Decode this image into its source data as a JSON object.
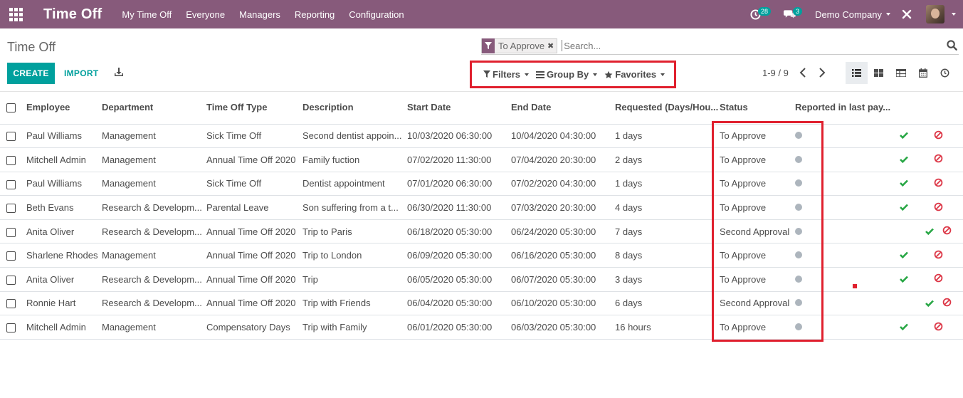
{
  "navbar": {
    "app_title": "Time Off",
    "menu": [
      "My Time Off",
      "Everyone",
      "Managers",
      "Reporting",
      "Configuration"
    ],
    "activity_count": "28",
    "message_count": "3",
    "company": "Demo Company",
    "bg_color": "#875a7b"
  },
  "control_panel": {
    "title": "Time Off",
    "search": {
      "facet_label": "To Approve",
      "placeholder": "Search..."
    },
    "create_label": "CREATE",
    "import_label": "IMPORT",
    "filters_label": "Filters",
    "groupby_label": "Group By",
    "favorites_label": "Favorites",
    "pager": "1-9 / 9"
  },
  "table": {
    "headers": [
      "Employee",
      "Department",
      "Time Off Type",
      "Description",
      "Start Date",
      "End Date",
      "Requested (Days/Hou...",
      "Status",
      "Reported in last pay..."
    ],
    "rows": [
      {
        "employee": "Paul Williams",
        "department": "Management",
        "type": "Sick Time Off",
        "description": "Second dentist appoin...",
        "start": "10/03/2020 06:30:00",
        "end": "10/04/2020 04:30:00",
        "requested": "1 days",
        "status": "To Approve"
      },
      {
        "employee": "Mitchell Admin",
        "department": "Management",
        "type": "Annual Time Off 2020",
        "description": "Family fuction",
        "start": "07/02/2020 11:30:00",
        "end": "07/04/2020 20:30:00",
        "requested": "2 days",
        "status": "To Approve"
      },
      {
        "employee": "Paul Williams",
        "department": "Management",
        "type": "Sick Time Off",
        "description": "Dentist appointment",
        "start": "07/01/2020 06:30:00",
        "end": "07/02/2020 04:30:00",
        "requested": "1 days",
        "status": "To Approve"
      },
      {
        "employee": "Beth Evans",
        "department": "Research & Developm...",
        "type": "Parental Leave",
        "description": "Son suffering from a t...",
        "start": "06/30/2020 11:30:00",
        "end": "07/03/2020 20:30:00",
        "requested": "4 days",
        "status": "To Approve"
      },
      {
        "employee": "Anita Oliver",
        "department": "Research & Developm...",
        "type": "Annual Time Off 2020",
        "description": "Trip to Paris",
        "start": "06/18/2020 05:30:00",
        "end": "06/24/2020 05:30:00",
        "requested": "7 days",
        "status": "Second Approval"
      },
      {
        "employee": "Sharlene Rhodes",
        "department": "Management",
        "type": "Annual Time Off 2020",
        "description": "Trip to London",
        "start": "06/09/2020 05:30:00",
        "end": "06/16/2020 05:30:00",
        "requested": "8 days",
        "status": "To Approve"
      },
      {
        "employee": "Anita Oliver",
        "department": "Research & Developm...",
        "type": "Annual Time Off 2020",
        "description": "Trip",
        "start": "06/05/2020 05:30:00",
        "end": "06/07/2020 05:30:00",
        "requested": "3 days",
        "status": "To Approve"
      },
      {
        "employee": "Ronnie Hart",
        "department": "Research & Developm...",
        "type": "Annual Time Off 2020",
        "description": "Trip with Friends",
        "start": "06/04/2020 05:30:00",
        "end": "06/10/2020 05:30:00",
        "requested": "6 days",
        "status": "Second Approval"
      },
      {
        "employee": "Mitchell Admin",
        "department": "Management",
        "type": "Compensatory Days",
        "description": "Trip with Family",
        "start": "06/01/2020 05:30:00",
        "end": "06/03/2020 05:30:00",
        "requested": "16 hours",
        "status": "To Approve"
      }
    ]
  },
  "colors": {
    "accent": "#00a09d",
    "approve_check": "#28a745",
    "refuse": "#dc3545",
    "highlight_border": "#e0202e"
  }
}
